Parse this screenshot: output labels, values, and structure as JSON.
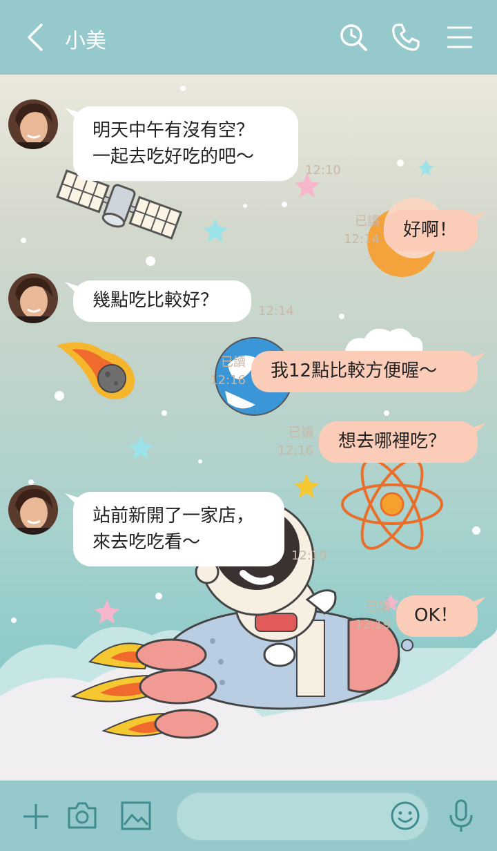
{
  "header": {
    "title": "小美",
    "icons": [
      "back-icon",
      "search-icon",
      "phone-icon",
      "menu-icon"
    ]
  },
  "messages": [
    {
      "id": 1,
      "side": "left",
      "text": "明天中午有沒有空？\n一起去吃好吃的吧～",
      "time": "12:10"
    },
    {
      "id": 2,
      "side": "right",
      "text": "好啊！",
      "read": "已讀",
      "time": "12:14"
    },
    {
      "id": 3,
      "side": "left",
      "text": "幾點吃比較好？",
      "time": "12:14"
    },
    {
      "id": 4,
      "side": "right",
      "text": "我12點比較方便喔～",
      "read": "已讀",
      "time": "12:16"
    },
    {
      "id": 5,
      "side": "right",
      "text": "想去哪裡吃？",
      "read": "已讀",
      "time": "12:16"
    },
    {
      "id": 6,
      "side": "left",
      "text": "站前新開了一家店，\n來去吃吃看～",
      "time": "12:19"
    },
    {
      "id": 7,
      "side": "right",
      "text": "OK！",
      "read": "已讀",
      "time": "12:19"
    }
  ],
  "bottom_bar": {
    "icons": [
      "plus-icon",
      "camera-icon",
      "image-icon",
      "emoji-icon",
      "microphone-icon"
    ],
    "input_value": ""
  },
  "colors": {
    "header": "#96c9cb",
    "my_bubble": "#fbcdb9",
    "their_bubble": "#ffffff",
    "meta_text": "#c8b8a6"
  }
}
